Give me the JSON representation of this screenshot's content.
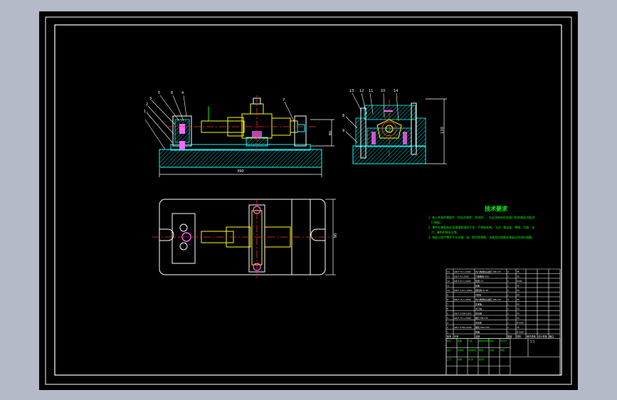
{
  "drawing": {
    "tech_title": "技术要求",
    "tech_lines": [
      "1. 装入夹具的零部件（包括外购件、外协件），均必须具有检验部门的合格证方能进",
      "   行装配。",
      "2. 零件在装配前必须清理和清洗干净，不得有毛刺、飞边、氧化皮、锈蚀、切屑、油",
      "   污、着色剂和灰尘等。",
      "3. 装配过程中零件不允许磕、碰、划伤和锈蚀，夹具定位面和夹紧面必须良好接触。"
    ],
    "dims": {
      "overall_length": "390",
      "side_height": "80",
      "side_width": "130",
      "plan_height": "90"
    },
    "balloons_front": [
      "5",
      "6",
      "4",
      "3",
      "2",
      "1",
      "7"
    ],
    "balloons_side": [
      "13",
      "12",
      "11",
      "10",
      "14",
      "8",
      "9"
    ],
    "bom": {
      "headers": [
        "序号",
        "代号",
        "名称",
        "数量",
        "材料",
        "单件重量",
        "总计重量",
        "备注"
      ],
      "rows": [
        [
          "14",
          "GB/T 70.1-2000",
          "内六角圆柱头螺钉 M8×25",
          "4",
          "35",
          "",
          "",
          ""
        ],
        [
          "13",
          "GB/T 41-2000",
          "六角螺母 M10",
          "2",
          "35",
          "",
          "",
          ""
        ],
        [
          "12",
          "GB/T 97.1-2002",
          "垫圈 10",
          "2",
          "65Mn",
          "",
          "",
          ""
        ],
        [
          "11",
          "",
          "压板",
          "1",
          "45",
          "",
          "",
          ""
        ],
        [
          "10",
          "GB/T 119.1-2000",
          "圆柱销 8×30",
          "2",
          "45",
          "",
          "",
          ""
        ],
        [
          "9",
          "",
          "V形块",
          "2",
          "20",
          "",
          "",
          ""
        ],
        [
          "8",
          "GB/T 70.1-2000",
          "内六角圆柱头螺钉 M6×20",
          "4",
          "35",
          "",
          "",
          ""
        ],
        [
          "7",
          "",
          "支承板",
          "1",
          "45",
          "",
          "",
          ""
        ],
        [
          "6",
          "",
          "对刀块",
          "1",
          "20",
          "",
          "",
          ""
        ],
        [
          "5",
          "GB/T 2208-1991",
          "定位键",
          "2",
          "45",
          "",
          "",
          ""
        ],
        [
          "4",
          "GB/T 70.1-2000",
          "螺钉 M8×30",
          "2",
          "35",
          "",
          "",
          ""
        ],
        [
          "3",
          "",
          "夹具体",
          "1",
          "HT200",
          "",
          "",
          ""
        ],
        [
          "2",
          "GB/T 5780-2000",
          "螺栓 M10×60",
          "2",
          "35",
          "",
          "",
          ""
        ],
        [
          "1",
          "",
          "底座",
          "1",
          "HT200",
          "",
          "",
          ""
        ]
      ]
    },
    "title_block": {
      "labels": [
        "标记",
        "处数",
        "分区",
        "更改文件号",
        "签名",
        "年月日",
        "设计",
        "标准化",
        "阶段标记",
        "重量",
        "比例",
        "审核",
        "工艺",
        "批准",
        "共 张",
        "第 张"
      ],
      "scale": "1:1"
    },
    "colors": {
      "line": "#ffffff",
      "part": "#00ffff",
      "shaft": "#ffff00",
      "center": "#ff3030",
      "dim": "#00ff00",
      "text": "#00ff00",
      "hatch": "#00c8c8",
      "pink": "#ff66ff"
    }
  }
}
